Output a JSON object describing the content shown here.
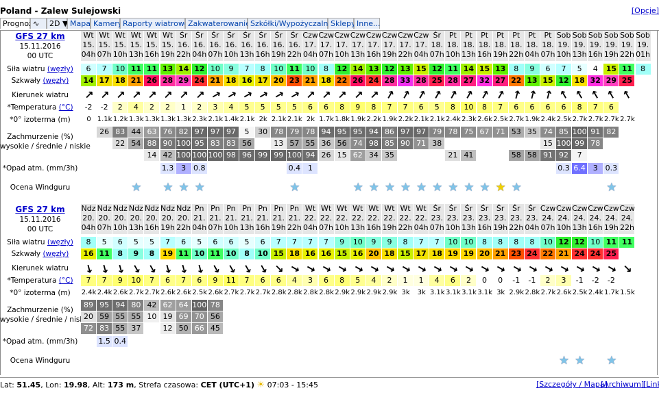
{
  "page": {
    "title": "Poland - Zalew Sulejowski",
    "options": "[Opcje]",
    "tabs": [
      "Prognoza",
      "",
      "2D",
      "Mapa",
      "Kamery",
      "Raporty wiatrowe",
      "Zakwaterowanie",
      "Szkółki/Wypożyczalnie",
      "Sklepy",
      "Inne..."
    ],
    "footer": {
      "lat_label": "Lat:",
      "lat": "51.45",
      "lon_label": "Lon:",
      "lon": "19.98",
      "alt_label": "Alt:",
      "alt": "173 m",
      "tz_label": "Strefa czasowa:",
      "tz": "CET (UTC+1)",
      "sun": "07:03 - 15:45",
      "link1": "[Szczegóły / Mapa]",
      "link2": "[Archiwum]",
      "link3": "[Link]"
    }
  },
  "labels": {
    "model": "GFS 27 km",
    "date": "15.11.2016",
    "run": "00 UTC",
    "wind_pre": "Siła wiatru",
    "wind_unit": "(węzły)",
    "gust_pre": "Szkwały",
    "gust_unit": "(węzły)",
    "dir": "Kierunek wiatru",
    "temp_pre": "*Temperatura",
    "temp_unit": "(°C)",
    "iso": "*0° izoterma (m)",
    "cloud1": "Zachmurzenie (%)",
    "cloud2": "wysokie / średnie / niskie",
    "rain": "*Opad atm. (mm/3h)",
    "rating": "Ocena Windguru"
  },
  "colors": {
    "wind": {
      "5": "#e6ffff",
      "6": "#d0ffff",
      "7": "#b8ffff",
      "8": "#a0fff8",
      "9": "#88ffe0",
      "10": "#70ffc8",
      "11": "#40ff60",
      "12": "#30f030",
      "13": "#60f000",
      "14": "#a0f000",
      "15": "#c8f000",
      "16": "#e8f000",
      "17": "#f0e000",
      "18": "#f8e000",
      "19": "#ffd800",
      "20": "#ffc000",
      "21": "#ffa000",
      "22": "#ff7800",
      "23": "#ff5000",
      "24": "#ff3030",
      "25": "#ff2050",
      "26": "#ff1060",
      "27": "#ff2080",
      "28": "#ff30a0",
      "29": "#ff40c0",
      "32": "#ff30e0",
      "33": "#f030f0"
    },
    "temp": {
      "-2": "#ffffff",
      "-1": "#ffffff",
      "0": "#ffffff",
      "1": "#ffffe0",
      "2": "#ffffc8",
      "3": "#ffffb0",
      "4": "#ffffa0",
      "5": "#ffff90",
      "6": "#ffff88",
      "7": "#ffff80",
      "8": "#ffff78",
      "9": "#ffff70",
      "10": "#ffff68",
      "11": "#ffff60"
    }
  },
  "blocks": [
    {
      "days": [
        "Wt",
        "Wt",
        "Wt",
        "Wt",
        "Wt",
        "Wt",
        "Śr",
        "Śr",
        "Śr",
        "Śr",
        "Śr",
        "Śr",
        "Śr",
        "Śr",
        "Czw",
        "Czw",
        "Czw",
        "Czw",
        "Czw",
        "Czw",
        "Czw",
        "Czw",
        "Śr",
        "Pt",
        "Pt",
        "Pt",
        "Pt",
        "Pt",
        "Pt",
        "Pt",
        "Sob",
        "Sob",
        "Sob",
        "Sob",
        "Sob",
        "Sob"
      ],
      "dates": [
        "15.",
        "15.",
        "15.",
        "15.",
        "15.",
        "15.",
        "16.",
        "16.",
        "16.",
        "16.",
        "16.",
        "16.",
        "16.",
        "16.",
        "17.",
        "17.",
        "17.",
        "17.",
        "17.",
        "17.",
        "17.",
        "17.",
        "18.",
        "18.",
        "18.",
        "18.",
        "18.",
        "18.",
        "18.",
        "18.",
        "19.",
        "19.",
        "19.",
        "19.",
        "19.",
        "19."
      ],
      "hours": [
        "04h",
        "07h",
        "10h",
        "13h",
        "16h",
        "19h",
        "22h",
        "04h",
        "07h",
        "10h",
        "13h",
        "16h",
        "19h",
        "22h",
        "04h",
        "07h",
        "10h",
        "13h",
        "16h",
        "19h",
        "22h",
        "04h",
        "07h",
        "10h",
        "13h",
        "16h",
        "19h",
        "22h",
        "04h",
        "07h",
        "10h",
        "13h",
        "16h",
        "19h",
        "22h",
        "01h"
      ],
      "wind": [
        "6",
        "7",
        "10",
        "11",
        "11",
        "13",
        "14",
        "12",
        "10",
        "9",
        "7",
        "8",
        "10",
        "11",
        "10",
        "8",
        "12",
        "14",
        "13",
        "12",
        "13",
        "15",
        "12",
        "11",
        "14",
        "15",
        "13",
        "8",
        "9",
        "6",
        "7",
        "5",
        "4",
        "15",
        "11",
        "8"
      ],
      "gust": [
        "14",
        "17",
        "18",
        "21",
        "26",
        "28",
        "29",
        "24",
        "21",
        "18",
        "16",
        "17",
        "20",
        "23",
        "21",
        "18",
        "22",
        "26",
        "24",
        "28",
        "33",
        "28",
        "25",
        "28",
        "27",
        "32",
        "27",
        "22",
        "13",
        "15",
        "12",
        "18",
        "32",
        "29",
        "25"
      ],
      "dirs": [
        225,
        225,
        225,
        225,
        225,
        225,
        225,
        225,
        240,
        240,
        240,
        240,
        240,
        240,
        225,
        225,
        225,
        225,
        225,
        210,
        210,
        210,
        210,
        210,
        210,
        210,
        210,
        195,
        195,
        195,
        150,
        150,
        150,
        150,
        150
      ],
      "temp": [
        "-2",
        "-2",
        "2",
        "4",
        "2",
        "2",
        "1",
        "2",
        "3",
        "4",
        "5",
        "5",
        "5",
        "5",
        "6",
        "6",
        "8",
        "9",
        "8",
        "7",
        "7",
        "6",
        "5",
        "8",
        "10",
        "8",
        "7",
        "6",
        "6",
        "6",
        "6",
        "8",
        "7",
        "6"
      ],
      "iso": [
        "0",
        "1.1k",
        "1.2k",
        "1.3k",
        "1.3k",
        "1.3k",
        "1.3k",
        "2.3k",
        "2.1k",
        "1.4k",
        "2.1k",
        "2k",
        "2.1k",
        "2.1k",
        "2k",
        "1.7k",
        "1.8k",
        "1.9k",
        "2.2k",
        "1.9k",
        "2.2k",
        "2.1k",
        "2.1k",
        "2.4k",
        "2.3k",
        "2.6k",
        "2.5k",
        "2.7k",
        "1.9k",
        "2.4k",
        "2.5k",
        "2.7k",
        "2.7k",
        "2.7k",
        "2.7k"
      ],
      "cloud_high": [
        "",
        "26",
        "83",
        "44",
        "63",
        "76",
        "82",
        "97",
        "97",
        "97",
        "5",
        "30",
        "78",
        "79",
        "78",
        "94",
        "95",
        "95",
        "94",
        "86",
        "97",
        "97",
        "79",
        "78",
        "75",
        "67",
        "71",
        "53",
        "35",
        "74",
        "85",
        "100",
        "91",
        "82"
      ],
      "cloud_mid": [
        "",
        "",
        "22",
        "54",
        "88",
        "90",
        "100",
        "95",
        "83",
        "83",
        "56",
        "",
        "13",
        "57",
        "55",
        "36",
        "56",
        "74",
        "98",
        "85",
        "90",
        "71",
        "38",
        "",
        "",
        "",
        "",
        "",
        "",
        "15",
        "100",
        "99",
        "78"
      ],
      "cloud_low": [
        "",
        "",
        "",
        "",
        "14",
        "42",
        "100",
        "100",
        "100",
        "98",
        "96",
        "99",
        "99",
        "100",
        "94",
        "26",
        "15",
        "62",
        "34",
        "35",
        "",
        "",
        "",
        "21",
        "41",
        "",
        "",
        "58",
        "58",
        "91",
        "92",
        "7",
        ""
      ],
      "rain": [
        "",
        "",
        "",
        "",
        "",
        "1.3",
        "3",
        "0.8",
        "",
        "",
        "",
        "",
        "",
        "0.4",
        "1",
        "",
        "",
        "",
        "",
        "",
        "",
        "",
        "",
        "",
        "",
        "",
        "",
        "",
        "",
        "",
        "0.3",
        "6.4",
        "3",
        "0.3",
        ""
      ],
      "stars": [
        0,
        0,
        0,
        1,
        0,
        1,
        1,
        1,
        0,
        0,
        0,
        0,
        0,
        1,
        0,
        0,
        0,
        1,
        1,
        1,
        1,
        1,
        1,
        1,
        1,
        1,
        2,
        1,
        0,
        0,
        0,
        0,
        0,
        1,
        0
      ]
    },
    {
      "days": [
        "Ndz",
        "Ndz",
        "Ndz",
        "Ndz",
        "Ndz",
        "Ndz",
        "Ndz",
        "Pn",
        "Pn",
        "Pn",
        "Pn",
        "Pn",
        "Pn",
        "Pn",
        "Wt",
        "Wt",
        "Wt",
        "Wt",
        "Wt",
        "Wt",
        "Wt",
        "Wt",
        "Śr",
        "Śr",
        "Śr",
        "Śr",
        "Śr",
        "Śr",
        "Śr",
        "Czw",
        "Czw",
        "Czw",
        "Czw",
        "Czw",
        "Czw"
      ],
      "dates": [
        "20.",
        "20.",
        "20.",
        "20.",
        "20.",
        "20.",
        "20.",
        "21.",
        "21.",
        "21.",
        "21.",
        "21.",
        "21.",
        "21.",
        "22.",
        "22.",
        "22.",
        "22.",
        "22.",
        "22.",
        "22.",
        "22.",
        "23.",
        "23.",
        "23.",
        "23.",
        "23.",
        "23.",
        "23.",
        "24.",
        "24.",
        "24.",
        "24.",
        "24.",
        "24."
      ],
      "hours": [
        "04h",
        "07h",
        "10h",
        "13h",
        "16h",
        "19h",
        "22h",
        "04h",
        "07h",
        "10h",
        "13h",
        "16h",
        "19h",
        "22h",
        "04h",
        "07h",
        "10h",
        "13h",
        "16h",
        "19h",
        "22h",
        "04h",
        "07h",
        "10h",
        "13h",
        "16h",
        "19h",
        "22h",
        "04h",
        "07h",
        "10h",
        "13h",
        "16h",
        "19h",
        "22h"
      ],
      "wind": [
        "8",
        "5",
        "6",
        "5",
        "5",
        "7",
        "6",
        "5",
        "6",
        "6",
        "5",
        "6",
        "7",
        "7",
        "7",
        "7",
        "9",
        "10",
        "9",
        "9",
        "8",
        "7",
        "7",
        "10",
        "10",
        "8",
        "8",
        "8",
        "8",
        "10",
        "12",
        "12",
        "10",
        "11",
        "11"
      ],
      "gust": [
        "16",
        "11",
        "8",
        "9",
        "8",
        "19",
        "11",
        "10",
        "11",
        "10",
        "8",
        "10",
        "15",
        "18",
        "16",
        "16",
        "15",
        "16",
        "20",
        "18",
        "15",
        "17",
        "18",
        "19",
        "19",
        "20",
        "21",
        "23",
        "24",
        "22",
        "21",
        "24",
        "24",
        "25"
      ],
      "dirs": [
        345,
        345,
        345,
        330,
        330,
        345,
        345,
        345,
        330,
        330,
        330,
        330,
        315,
        300,
        300,
        300,
        300,
        300,
        300,
        300,
        300,
        300,
        300,
        300,
        300,
        300,
        300,
        300,
        300,
        300,
        300,
        300,
        300,
        300,
        315
      ],
      "temp": [
        "7",
        "7",
        "9",
        "10",
        "7",
        "6",
        "7",
        "6",
        "9",
        "11",
        "7",
        "6",
        "6",
        "4",
        "3",
        "6",
        "8",
        "5",
        "4",
        "2",
        "1",
        "1",
        "4",
        "6",
        "2",
        "0",
        "0",
        "-1",
        "-1",
        "2",
        "3",
        "-1",
        "-2",
        "-2"
      ],
      "iso": [
        "2.4k",
        "2.4k",
        "2.6k",
        "2.7k",
        "2.7k",
        "2.6k",
        "2.6k",
        "2.5k",
        "2.6k",
        "2.7k",
        "2.7k",
        "2.7k",
        "2.8k",
        "2.8k",
        "2.8k",
        "2.8k",
        "2.9k",
        "2.9k",
        "2.9k",
        "2.9k",
        "3k",
        "3k",
        "3.1k",
        "3.1k",
        "3.1k",
        "3.1k",
        "3k",
        "2.9k",
        "2.8k",
        "2.7k",
        "2.6k",
        "2.5k",
        "2.4k",
        "1.7k",
        "1.5k"
      ],
      "cloud_high": [
        "89",
        "95",
        "94",
        "80",
        "42",
        "62",
        "64",
        "100",
        "78"
      ],
      "cloud_mid": [
        "20",
        "59",
        "55",
        "55",
        "10",
        "19",
        "69",
        "70",
        "56"
      ],
      "cloud_low": [
        "72",
        "83",
        "55",
        "37",
        "",
        "12",
        "50",
        "66",
        "45"
      ],
      "rain": [
        "",
        "1.5",
        "0.4"
      ],
      "stars": [
        0,
        0,
        0,
        0,
        0,
        0,
        0,
        0,
        0,
        0,
        0,
        0,
        0,
        0,
        0,
        0,
        0,
        0,
        0,
        0,
        0,
        0,
        0,
        0,
        0,
        0,
        0,
        0,
        0,
        0,
        1,
        1,
        0,
        1,
        0
      ]
    }
  ]
}
